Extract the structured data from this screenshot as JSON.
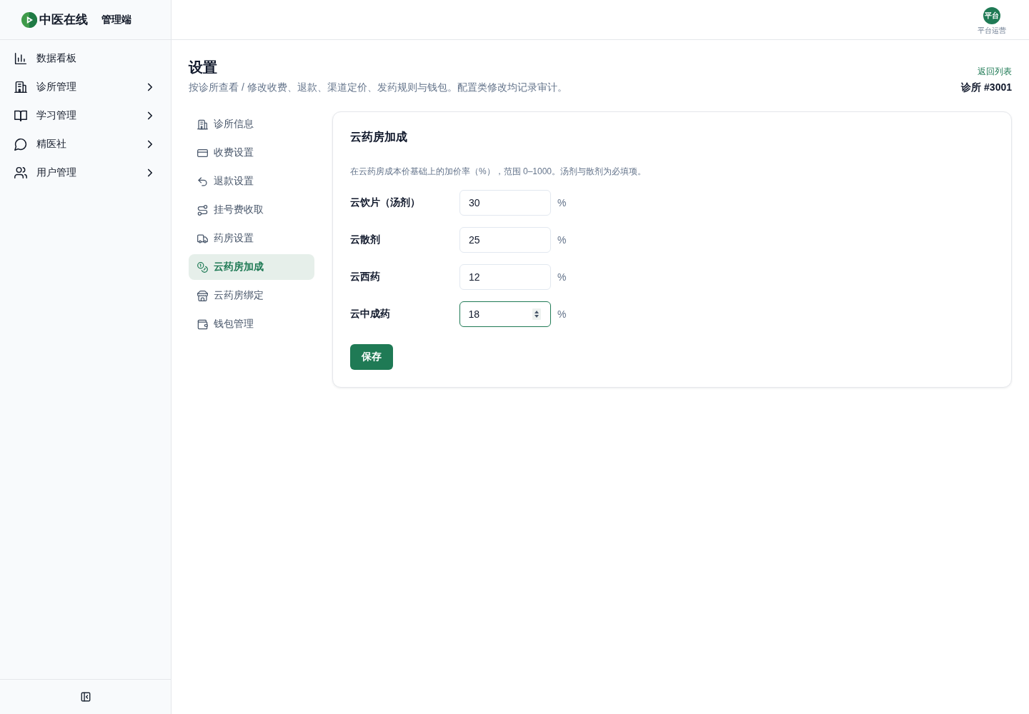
{
  "brand": {
    "name": "中医在线",
    "subtitle": "管理端"
  },
  "sidebar": {
    "items": [
      {
        "label": "数据看板",
        "has_submenu": false
      },
      {
        "label": "诊所管理",
        "has_submenu": true
      },
      {
        "label": "学习管理",
        "has_submenu": true
      },
      {
        "label": "精医社",
        "has_submenu": true
      },
      {
        "label": "用户管理",
        "has_submenu": true
      }
    ]
  },
  "user": {
    "avatar_text": "平台",
    "role": "平台运营"
  },
  "page": {
    "title": "设置",
    "subtitle": "按诊所查看 / 修改收费、退款、渠道定价、发药规则与钱包。配置类修改均记录审计。",
    "back_link": "返回列表",
    "clinic": "诊所 #3001"
  },
  "settings_nav": {
    "items": [
      {
        "label": "诊所信息",
        "selected": false
      },
      {
        "label": "收费设置",
        "selected": false
      },
      {
        "label": "退款设置",
        "selected": false
      },
      {
        "label": "挂号费收取",
        "selected": false
      },
      {
        "label": "药房设置",
        "selected": false
      },
      {
        "label": "云药房加成",
        "selected": true
      },
      {
        "label": "云药房绑定",
        "selected": false
      },
      {
        "label": "钱包管理",
        "selected": false
      }
    ]
  },
  "panel": {
    "title": "云药房加成",
    "description": "在云药房成本价基础上的加价率（%），范围 0–1000。汤剂与散剂为必填项。",
    "fields": [
      {
        "label": "云饮片（汤剂）",
        "value": "30",
        "unit": "%",
        "focused": false
      },
      {
        "label": "云散剂",
        "value": "25",
        "unit": "%",
        "focused": false
      },
      {
        "label": "云西药",
        "value": "12",
        "unit": "%",
        "focused": false
      },
      {
        "label": "云中成药",
        "value": "18",
        "unit": "%",
        "focused": true
      }
    ],
    "save_button": "保存"
  }
}
